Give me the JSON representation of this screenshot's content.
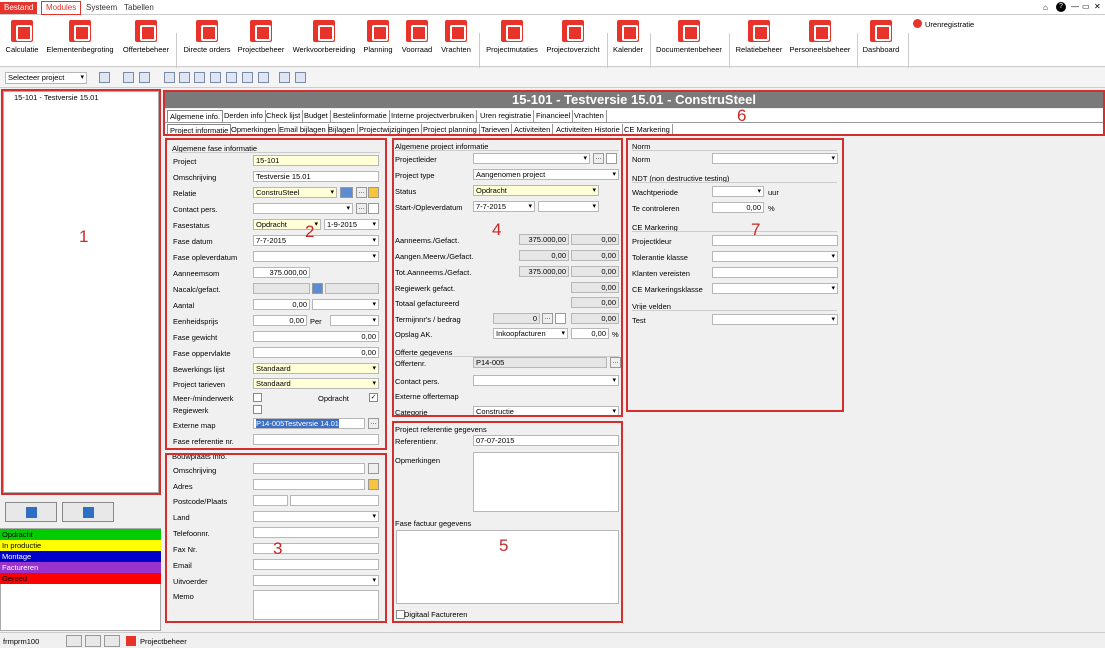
{
  "menu": {
    "bestand": "Bestand",
    "modules": "Modules",
    "systeem": "Systeem",
    "tabellen": "Tabellen",
    "window_controls": [
      "⌂",
      "?",
      "—",
      "▭",
      "✕"
    ]
  },
  "ribbon": [
    {
      "label": "Calculatie",
      "icon": "calculator-icon"
    },
    {
      "label": "Elementenbegroting",
      "icon": "calculator-icon"
    },
    {
      "label": "Offertebeheer",
      "icon": "briefcase-icon"
    },
    {
      "label": "Directe orders",
      "icon": "document-icon"
    },
    {
      "label": "Projectbeheer",
      "icon": "gears-icon"
    },
    {
      "label": "Werkvoorbereiding",
      "icon": "gears-icon"
    },
    {
      "label": "Planning",
      "icon": "planning-icon"
    },
    {
      "label": "Voorraad",
      "icon": "warehouse-icon"
    },
    {
      "label": "Vrachten",
      "icon": "truck-icon"
    },
    {
      "label": "Projectmutaties",
      "icon": "mutations-icon"
    },
    {
      "label": "Projectoverzicht",
      "icon": "overview-icon"
    },
    {
      "label": "Kalender",
      "icon": "calendar-icon"
    },
    {
      "label": "Documentenbeheer",
      "icon": "documents-icon"
    },
    {
      "label": "Relatiebeheer",
      "icon": "relations-icon"
    },
    {
      "label": "Personeelsbeheer",
      "icon": "people-icon"
    },
    {
      "label": "Dashboard",
      "icon": "dashboard-icon"
    }
  ],
  "uren": "Urenregistratie",
  "toolbar": {
    "select_project": "Selecteer project"
  },
  "tree": {
    "item": "15-101 - Testversie 15.01"
  },
  "legend": [
    {
      "label": "Opdracht",
      "color": "#00cc00"
    },
    {
      "label": "In productie",
      "color": "#ffff00"
    },
    {
      "label": "Montage",
      "color": "#0000cc"
    },
    {
      "label": "Factureren",
      "color": "#9933cc"
    },
    {
      "label": "Gereed",
      "color": "#ff0000"
    }
  ],
  "status": {
    "user": "frmprm100",
    "module": "Projectbeheer"
  },
  "title": "15-101 - Testversie 15.01 - ConstruSteel",
  "tabs1": [
    "Algemene info.",
    "Derden info",
    "Check lijst",
    "Budget",
    "Bestelinformatie",
    "Interne projectverbruiken",
    "Uren registratie",
    "Financieel",
    "Vrachten"
  ],
  "tabs2": [
    "Project informatie",
    "Opmerkingen",
    "Email bijlagen",
    "Bijlagen",
    "Projectwijzigingen",
    "Project planning",
    "Tarieven",
    "Activiteiten",
    "Activiteiten Historie",
    "CE Markering"
  ],
  "p2": {
    "title": "Algemene fase informatie",
    "project_l": "Project",
    "project_v": "15-101",
    "oms_l": "Omschrijving",
    "oms_v": "Testversie 15.01",
    "relatie_l": "Relatie",
    "relatie_v": "ConstruSteel",
    "contact_l": "Contact pers.",
    "fasestatus_l": "Fasestatus",
    "fasestatus_v": "Opdracht",
    "fasestatus_d": "1-9-2015",
    "fasedatum_l": "Fase datum",
    "fasedatum_v": "7-7-2015",
    "opleverdatum_l": "Fase opleverdatum",
    "aanneemsom_l": "Aanneemsom",
    "aanneemsom_v": "375.000,00",
    "nacalc_l": "Nacalc/gefact.",
    "aantal_l": "Aantal",
    "aantal_v": "0,00",
    "eenheid_l": "Eenheidsprijs",
    "eenheid_v": "0,00",
    "per_l": "Per",
    "gewicht_l": "Fase gewicht",
    "gewicht_v": "0,00",
    "opp_l": "Fase oppervlakte",
    "opp_v": "0,00",
    "bewerk_l": "Bewerkings lijst",
    "bewerk_v": "Standaard",
    "tarief_l": "Project tarieven",
    "tarief_v": "Standaard",
    "meer_l": "Meer-/minderwerk",
    "opdracht_l": "Opdracht",
    "regie_l": "Regiewerk",
    "extmap_l": "Externe map",
    "extmap_v": "P14-005Testversie 14.01",
    "faseref_l": "Fase referentie nr."
  },
  "p3": {
    "title": "Bouwplaats info.",
    "oms_l": "Omschrijving",
    "adres_l": "Adres",
    "pc_l": "Postcode/Plaats",
    "land_l": "Land",
    "tel_l": "Telefoonnr.",
    "fax_l": "Fax Nr.",
    "email_l": "Email",
    "uit_l": "Uitvoerder",
    "memo_l": "Memo"
  },
  "p4": {
    "title": "Algemene project informatie",
    "leider_l": "Projectleider",
    "type_l": "Project type",
    "type_v": "Aangenomen project",
    "status_l": "Status",
    "status_v": "Opdracht",
    "start_l": "Start-/Opleverdatum",
    "start_v": "7-7-2015",
    "aan_l": "Aanneems./Gefact.",
    "aan_v": "375.000,00",
    "aan_v2": "0,00",
    "meer_l": "Aangen.Meerw./Gefact.",
    "meer_v": "0,00",
    "meer_v2": "0,00",
    "tot_l": "Tot.Aanneems./Gefact.",
    "tot_v": "375.000,00",
    "tot_v2": "0,00",
    "regie_l": "Regiewerk gefact.",
    "regie_v": "0,00",
    "totaal_l": "Totaal gefactureerd",
    "totaal_v": "0,00",
    "termijn_l": "Termijnnr's / bedrag",
    "termijn_v": "0",
    "termijn_v2": "0,00",
    "opslag_l": "Opslag AK.",
    "opslag_v": "Inkoopfacturen",
    "opslag_v2": "0,00",
    "pct": "%",
    "offerte_title": "Offerte gegevens",
    "offnr_l": "Offertenr.",
    "offnr_v": "P14-005",
    "contact_l": "Contact pers.",
    "ext_l": "Externe offertemap",
    "cat_l": "Categorie",
    "cat_v": "Constructie"
  },
  "p5": {
    "title": "Project referentie gegevens",
    "ref_l": "Referentienr.",
    "ref_v": "07-07-2015",
    "opm_l": "Opmerkingen",
    "fase_title": "Fase factuur gegevens",
    "digi_l": "Digitaal Factureren"
  },
  "p7": {
    "norm_title": "Norm",
    "norm_l": "Norm",
    "ndt_title": "NDT (non destructive testing)",
    "wacht_l": "Wachtperiode",
    "uur": "uur",
    "te_l": "Te controleren",
    "te_v": "0,00",
    "pct": "%",
    "ce_title": "CE Markering",
    "kleur_l": "Projectkleur",
    "tol_l": "Tolerantie klasse",
    "klant_l": "Klanten vereisten",
    "cek_l": "CE Markeringsklasse",
    "vrij_title": "Vrije velden",
    "test_l": "Test"
  },
  "annotations": [
    "1",
    "2",
    "3",
    "4",
    "5",
    "6",
    "7"
  ]
}
